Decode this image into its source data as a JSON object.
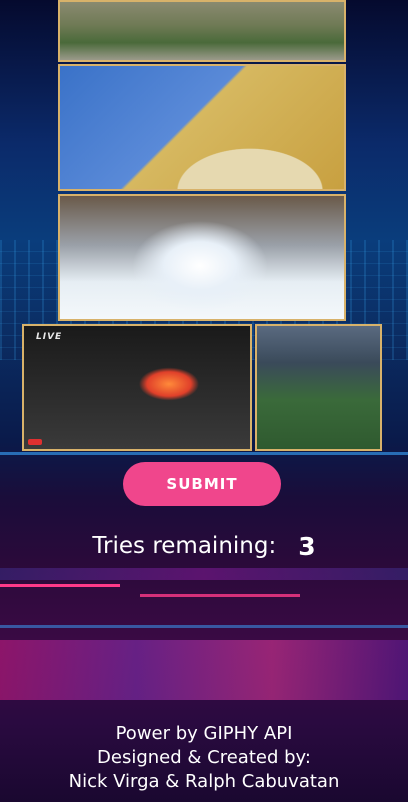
{
  "gifs": [
    {
      "name": "garden-gif",
      "alt": ""
    },
    {
      "name": "rollercoaster-gif",
      "alt": ""
    },
    {
      "name": "water-ride-gif",
      "alt": ""
    },
    {
      "name": "volcano-gif",
      "live_label": "LIVE",
      "alt": ""
    },
    {
      "name": "soccer-gif",
      "alt": ""
    }
  ],
  "submit_label": "SUBMIT",
  "tries": {
    "label": "Tries remaining:",
    "count": "3"
  },
  "footer": {
    "line1": "Power by GIPHY API",
    "line2": "Designed & Created by:",
    "line3": "Nick Virga & Ralph Cabuvatan"
  },
  "colors": {
    "submit_bg": "#f0468c",
    "frame_border": "#d8b26a"
  }
}
